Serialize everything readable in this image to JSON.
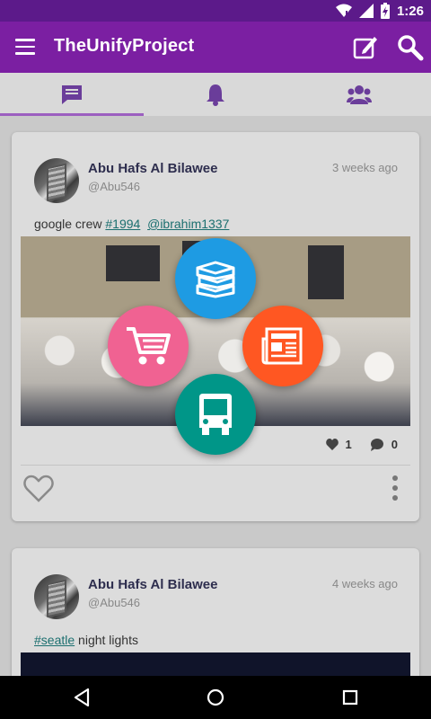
{
  "status_bar": {
    "time": "1:26"
  },
  "app_bar": {
    "title": "TheUnifyProject"
  },
  "tabs": [
    {
      "name": "messages",
      "selected": true
    },
    {
      "name": "notifications",
      "selected": false
    },
    {
      "name": "groups",
      "selected": false
    }
  ],
  "posts": [
    {
      "author": "Abu Hafs Al Bilawee",
      "handle": "@Abu546",
      "time": "3 weeks ago",
      "text_prefix": "google crew ",
      "hashtag": "#1994",
      "mention": "@ibrahim1337",
      "likes": "1",
      "comments": "0"
    },
    {
      "author": "Abu Hafs Al Bilawee",
      "handle": "@Abu546",
      "time": "4 weeks ago",
      "hashtag": "#seatle",
      "text_suffix": " night lights"
    }
  ],
  "fab_menu": [
    {
      "icon": "books-icon",
      "color": "#1e9be3"
    },
    {
      "icon": "shopping-cart-icon",
      "color": "#f06292"
    },
    {
      "icon": "newspaper-icon",
      "color": "#ff5722"
    },
    {
      "icon": "bus-icon",
      "color": "#009688"
    }
  ],
  "colors": {
    "app_bar": "#7b1fa2",
    "status_bar": "#5c1a8a",
    "accent": "#6a3d9a"
  }
}
